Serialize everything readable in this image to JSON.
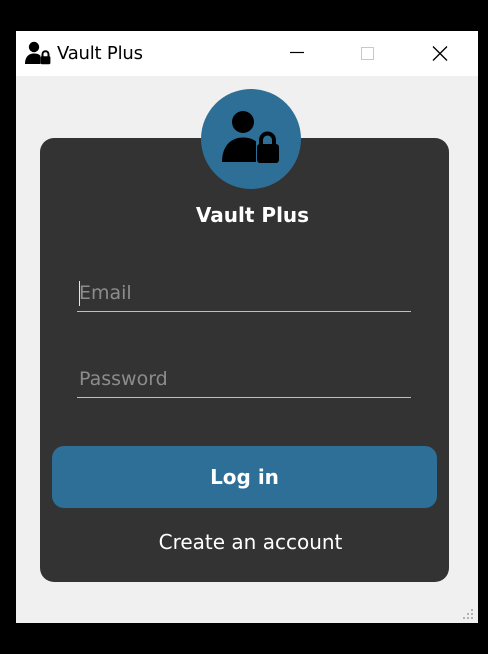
{
  "window": {
    "title": "Vault Plus",
    "app_icon": "user-lock-icon",
    "controls": {
      "minimize": "minimize-icon",
      "maximize": "maximize-icon",
      "close": "close-icon"
    }
  },
  "login": {
    "avatar_icon": "user-lock-icon",
    "app_name": "Vault Plus",
    "email_placeholder": "Email",
    "email_value": "",
    "password_placeholder": "Password",
    "password_value": "",
    "login_label": "Log in",
    "create_account_label": "Create an account"
  },
  "colors": {
    "window_background": "#f0f0f0",
    "card_background": "#333333",
    "accent": "#2e6f97",
    "text": "#ffffff",
    "placeholder": "#8c8c8c"
  }
}
